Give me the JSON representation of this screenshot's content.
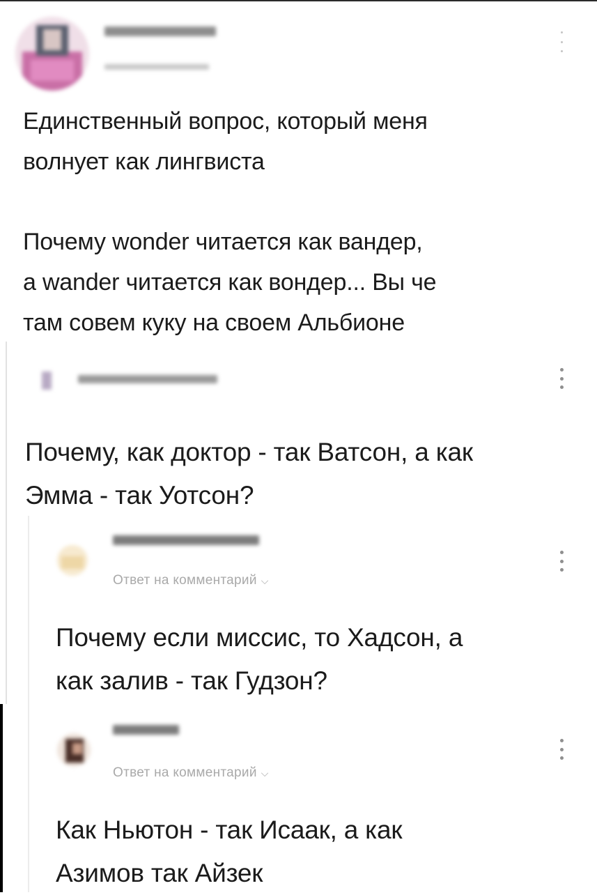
{
  "post": {
    "lines": [
      "Единственный вопрос, который меня",
      "волнует как лингвиста",
      "",
      "Почему wonder читается как вандер,",
      "а wander читается как вондер... Вы че",
      "там совем куку на своем Альбионе"
    ]
  },
  "comments": [
    {
      "lines": [
        "Почему, как доктор - так Ватсон, а как",
        "Эмма - так Уотсон?"
      ]
    },
    {
      "reply_label": "Ответ на комментарий",
      "lines": [
        "Почему если миссис, то Хадсон, а",
        "как залив - так Гудзон?"
      ]
    },
    {
      "reply_label": "Ответ на комментарий",
      "lines": [
        "Как Ньютон - так Исаак, а как",
        "Азимов так Айзек"
      ]
    }
  ],
  "icons": {
    "more": "more-vertical-icon",
    "chevron": "chevron-down-icon"
  },
  "colors": {
    "text": "#1b1b1b",
    "muted": "#a9a9a9",
    "background": "#ffffff"
  }
}
